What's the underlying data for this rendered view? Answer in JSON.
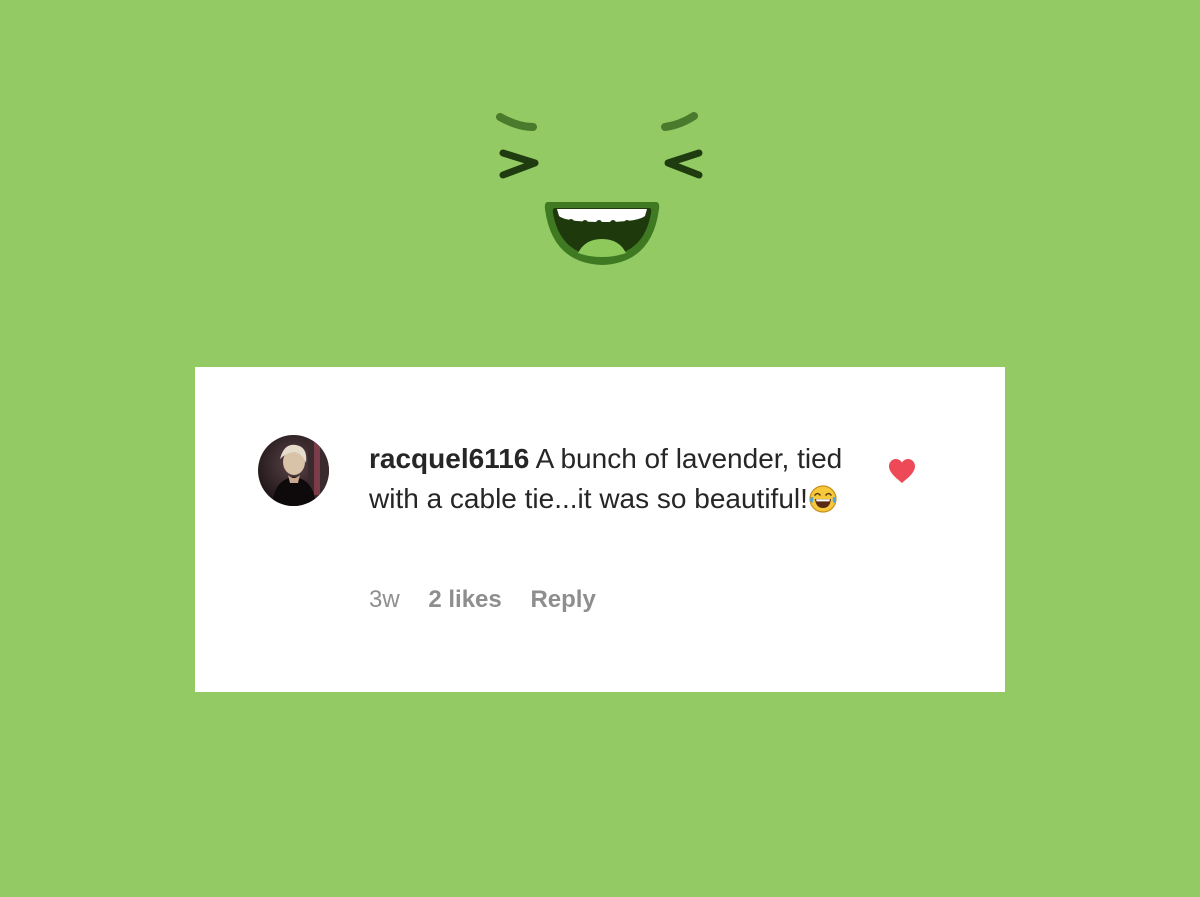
{
  "colors": {
    "background": "#93ca63",
    "card": "#ffffff",
    "heart": "#ed4956",
    "text_primary": "#262626",
    "text_secondary": "#8e8e8e"
  },
  "comment": {
    "username": "racquel6116",
    "text": "A bunch of lavender, tied with a cable tie...it was so beautiful!",
    "emoji_icon": "face-with-tears-of-joy-icon",
    "liked": true,
    "like_icon": "heart-filled-icon"
  },
  "meta": {
    "time": "3w",
    "likes": "2 likes",
    "reply": "Reply"
  },
  "decoration": {
    "icon": "laughing-face-icon"
  }
}
